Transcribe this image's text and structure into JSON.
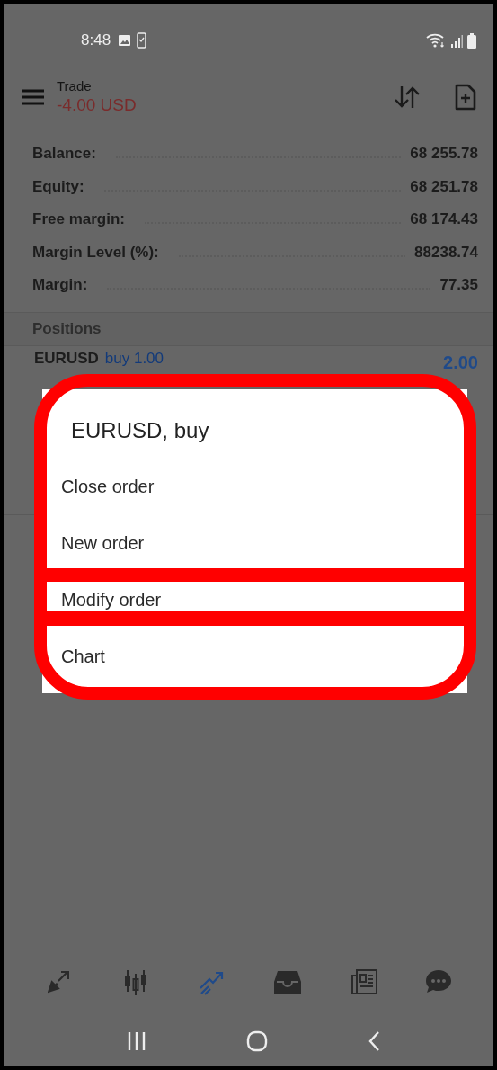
{
  "status_bar": {
    "time": "8:48"
  },
  "header": {
    "title": "Trade",
    "subtitle": "-4.00 USD"
  },
  "account": [
    {
      "label": "Balance:",
      "value": "68 255.78"
    },
    {
      "label": "Equity:",
      "value": "68 251.78"
    },
    {
      "label": "Free margin:",
      "value": "68 174.43"
    },
    {
      "label": "Margin Level (%):",
      "value": "88238.74"
    },
    {
      "label": "Margin:",
      "value": "77.35"
    }
  ],
  "positions": {
    "heading": "Positions",
    "items": [
      {
        "symbol": "EURUSD",
        "side": "buy 1.00",
        "profit": "2.00"
      }
    ]
  },
  "dialog": {
    "title": "EURUSD, buy",
    "outlined": true,
    "items": [
      {
        "label": "Close order",
        "highlighted": false
      },
      {
        "label": "New order",
        "highlighted": false
      },
      {
        "label": "Modify order",
        "highlighted": true
      },
      {
        "label": "Chart",
        "highlighted": false
      }
    ]
  },
  "bottom_nav": [
    {
      "kind": "quotes",
      "selected": false
    },
    {
      "kind": "chart",
      "selected": false
    },
    {
      "kind": "trade",
      "selected": true
    },
    {
      "kind": "history",
      "selected": false
    },
    {
      "kind": "news",
      "selected": false
    },
    {
      "kind": "chat",
      "selected": false
    }
  ]
}
